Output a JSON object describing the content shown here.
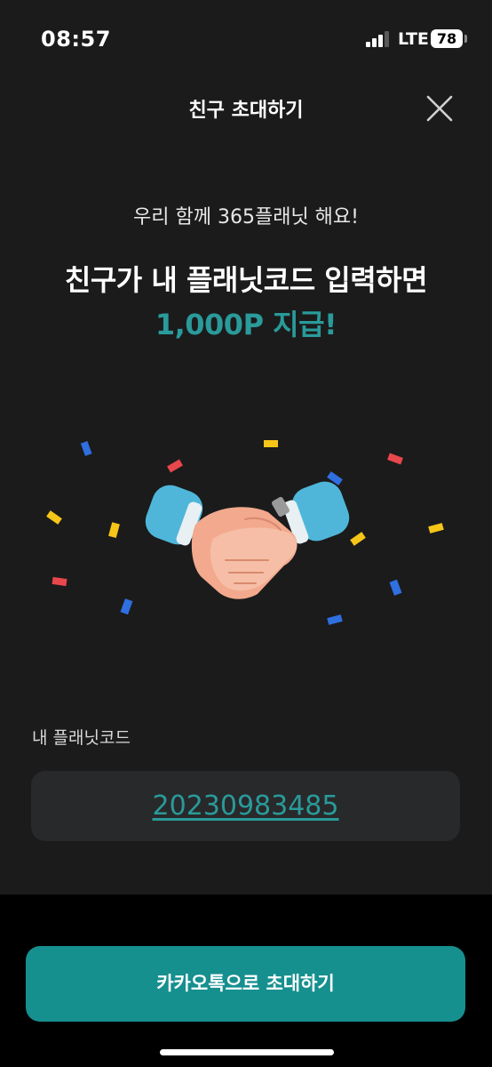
{
  "status_bar": {
    "time": "08:57",
    "network": "LTE",
    "battery": "78"
  },
  "header": {
    "title": "친구 초대하기",
    "close_icon": "close-icon"
  },
  "promo": {
    "subtitle": "우리 함께 365플래닛 해요!",
    "headline": "친구가 내 플래닛코드 입력하면",
    "reward": "1,000P 지급!",
    "illustration_icon": "handshake-icon"
  },
  "code_section": {
    "label": "내 플래닛코드",
    "code": "20230983485"
  },
  "invite_button": {
    "label": "카카오톡으로 초대하기"
  },
  "colors": {
    "accent": "#2a9a9a",
    "button": "#168f8f",
    "background": "#1b1b1c",
    "code_box": "#28292b"
  }
}
